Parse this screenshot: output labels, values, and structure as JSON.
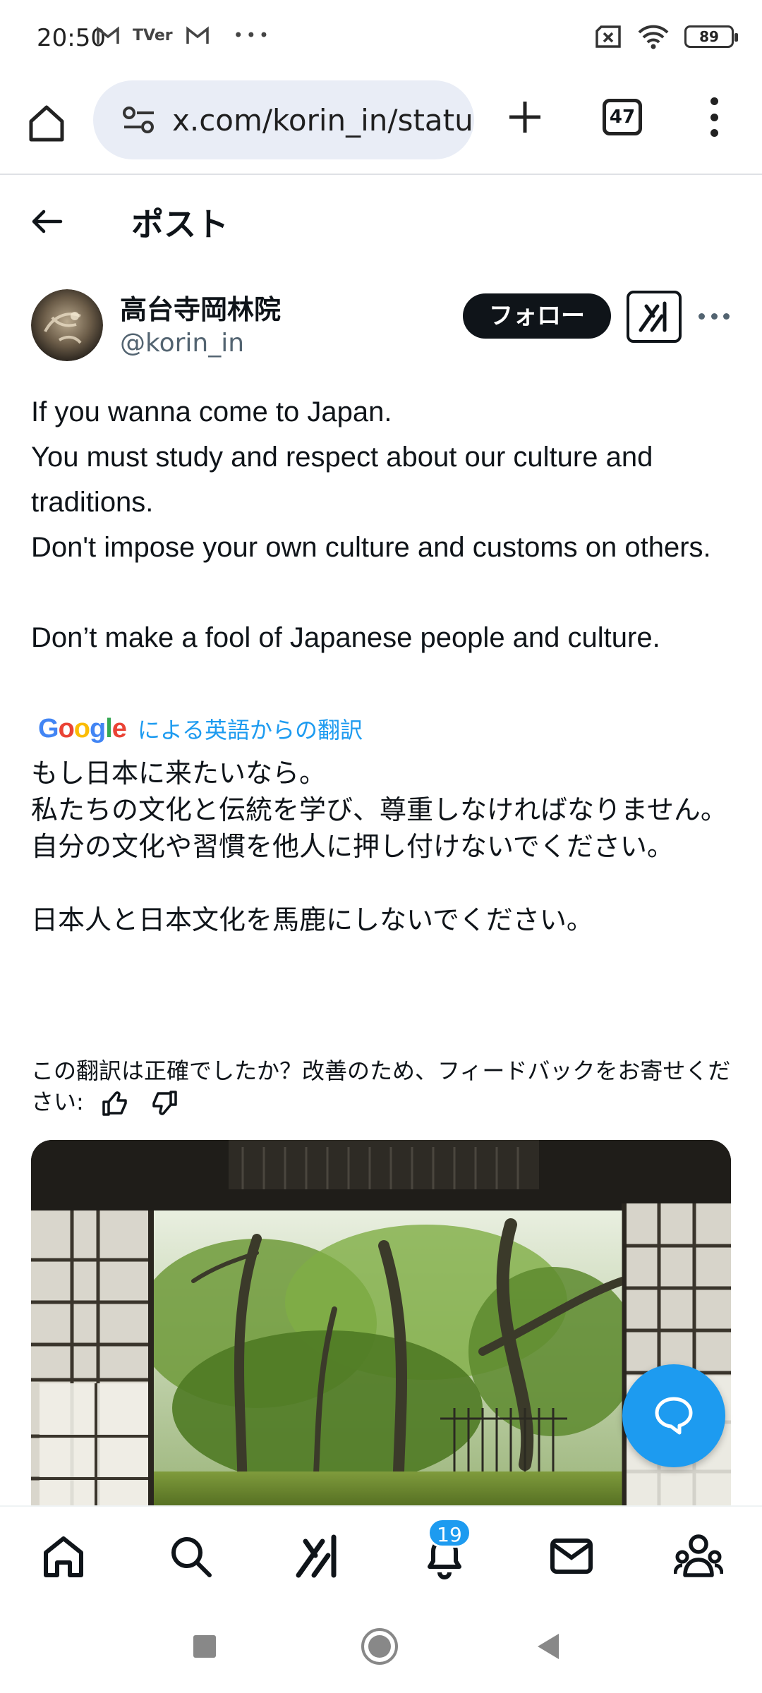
{
  "status_bar": {
    "time": "20:50",
    "notif_icons": [
      "gmail-icon",
      "tver-icon",
      "gmail-icon",
      "more-icon"
    ],
    "tver_text": "TVer",
    "more_text": "•••",
    "battery": "89"
  },
  "browser": {
    "url": "x.com/korin_in/status",
    "tab_count": "47"
  },
  "post_header": {
    "title": "ポスト"
  },
  "author": {
    "name": "高台寺岡林院",
    "handle": "@korin_in",
    "follow_label": "フォロー"
  },
  "post": {
    "text": "If you wanna come to Japan.\nYou must study and respect about our culture and traditions.\nDon't impose your own culture and customs on others.\n\nDon’t make a fool of Japanese people and culture.",
    "translation_provider": "Google",
    "translation_label": "による英語からの翻訳",
    "translated_text": "もし日本に来たいなら。\n私たちの文化と伝統を学び、尊重しなければなりません。\n自分の文化や習慣を他人に押し付けないでください。\n\n日本人と日本文化を馬鹿にしないでください。",
    "feedback_text": "この翻訳は正確でしたか？改善のため、フィードバックをお寄せください:"
  },
  "bottom_nav": {
    "notifications_badge": "19",
    "items": [
      "home-icon",
      "search-icon",
      "grok-icon",
      "notifications-icon",
      "messages-icon",
      "communities-icon"
    ]
  },
  "colors": {
    "accent": "#1d9bf0",
    "text": "#0f1419",
    "secondary_text": "#536471",
    "url_bar_bg": "#e9edf6"
  }
}
